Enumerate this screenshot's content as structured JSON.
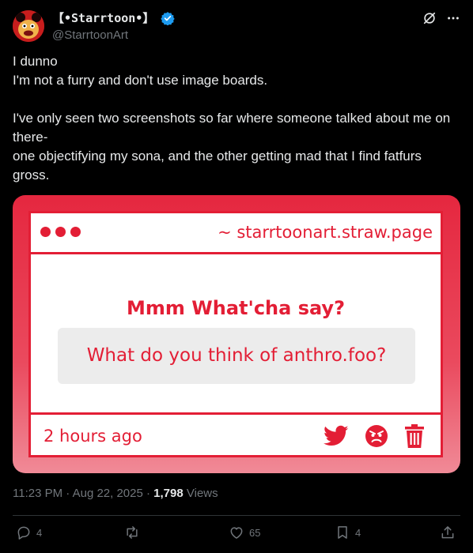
{
  "author": {
    "display_name": "【•Starrtoon•】",
    "handle": "@StarrtoonArt"
  },
  "tweet": {
    "paragraph_1": "I dunno\nI'm not a furry and don't use image boards.",
    "paragraph_2": "I've only seen two screenshots so far where someone talked about me on there-\none objectifying my sona, and the other getting mad that I find fatfurs gross."
  },
  "card": {
    "url": "~ starrtoonart.straw.page",
    "prompt": "Mmm What'cha say?",
    "question": "What do you think of anthro.foo?",
    "time_ago": "2 hours ago",
    "icons": [
      "twitter-bird-icon",
      "angry-face-icon",
      "trash-icon"
    ],
    "accent": "#e31e35"
  },
  "meta": {
    "timestamp": "11:23 PM · Aug 22, 2025 · ",
    "views_count": "1,798",
    "views_label": " Views"
  },
  "actions": {
    "replies": "4",
    "reposts": "",
    "likes": "65",
    "bookmarks": "4"
  },
  "colors": {
    "background": "#000000",
    "text": "#e7e9ea",
    "secondary": "#71767b",
    "verified": "#1d9bf0"
  }
}
